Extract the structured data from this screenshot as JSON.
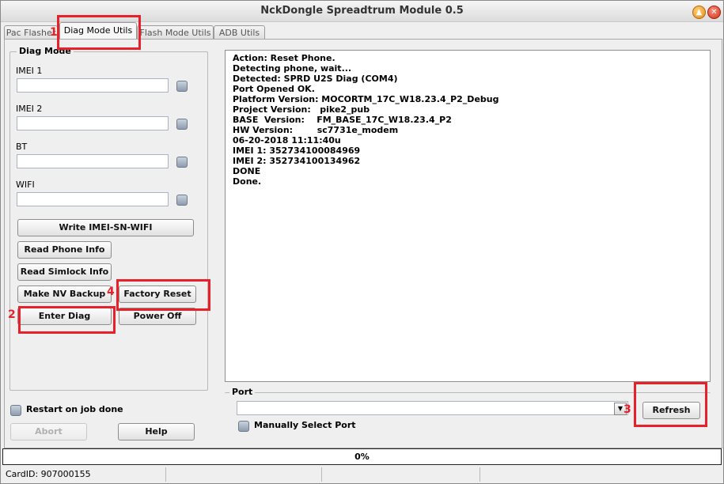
{
  "window": {
    "title": "NckDongle Spreadtrum Module 0.5",
    "minimize_icon": "up-arrow-icon",
    "close_icon": "close-icon"
  },
  "tabs": [
    {
      "label": "Pac Flasher",
      "active": false
    },
    {
      "label": "Diag Mode Utils",
      "active": true
    },
    {
      "label": "Flash Mode Utils",
      "active": false
    },
    {
      "label": "ADB Utils",
      "active": false
    }
  ],
  "diag": {
    "group_label": "Diag Mode",
    "imei1_label": "IMEI 1",
    "imei1_value": "",
    "imei2_label": "IMEI 2",
    "imei2_value": "",
    "bt_label": "BT",
    "bt_value": "",
    "wifi_label": "WIFI",
    "wifi_value": "",
    "buttons": {
      "write": "Write IMEI-SN-WIFI",
      "read_phone": "Read Phone Info",
      "read_simlock": "Read Simlock Info",
      "make_nv": "Make NV Backup",
      "factory_reset": "Factory Reset",
      "enter_diag": "Enter Diag",
      "power_off": "Power Off"
    }
  },
  "bottom_left": {
    "restart_label": "Restart on job done",
    "abort_label": "Abort",
    "help_label": "Help"
  },
  "log": [
    "Action: Reset Phone.",
    "Detecting phone, wait...",
    "Detected: SPRD U2S Diag (COM4)",
    "Port Opened OK.",
    "Platform Version: MOCORTM_17C_W18.23.4_P2_Debug",
    "Project Version:   pike2_pub",
    "BASE  Version:    FM_BASE_17C_W18.23.4_P2",
    "HW Version:        sc7731e_modem",
    "06-20-2018 11:11:40u",
    "IMEI 1: 352734100084969",
    "IMEI 2: 352734100134962",
    "DONE",
    "Done."
  ],
  "port": {
    "group_label": "Port",
    "selected": "",
    "manual_label": "Manually Select Port",
    "refresh_label": "Refresh"
  },
  "progress": {
    "text": "0%",
    "value": 0
  },
  "status": {
    "card_id": "CardID: 907000155"
  },
  "annotations": {
    "n1": "1",
    "n2": "2",
    "n3": "3",
    "n4": "4",
    "color": "#e8202a"
  }
}
